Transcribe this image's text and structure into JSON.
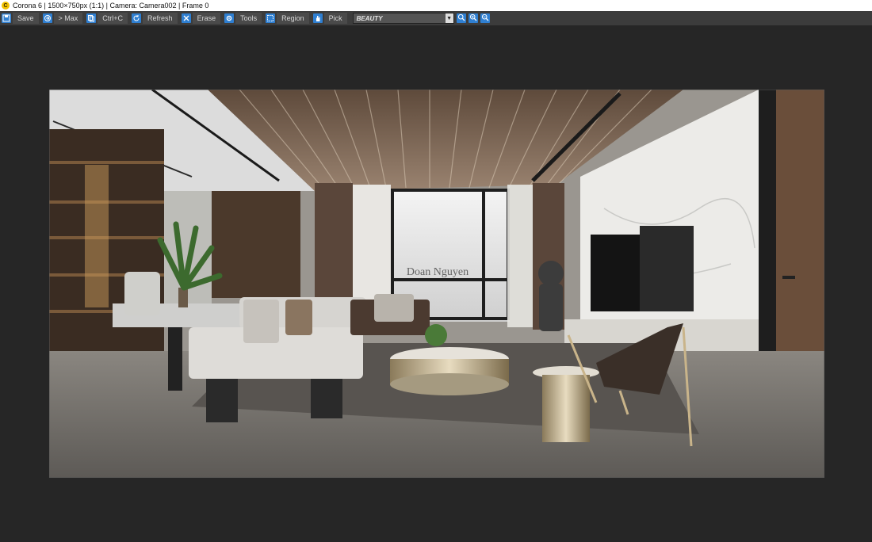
{
  "window": {
    "title": "Corona 6 | 1500×750px (1:1) | Camera: Camera002 | Frame 0",
    "icon": "corona-app-icon"
  },
  "toolbar": {
    "buttons": [
      {
        "label": "Save",
        "icon": "save-icon"
      },
      {
        "label": "> Max",
        "icon": "max-icon"
      },
      {
        "label": "Ctrl+C",
        "icon": "copy-icon"
      },
      {
        "label": "Refresh",
        "icon": "refresh-icon"
      },
      {
        "label": "Erase",
        "icon": "erase-icon"
      },
      {
        "label": "Tools",
        "icon": "gear-icon"
      },
      {
        "label": "Region",
        "icon": "region-icon"
      },
      {
        "label": "Pick",
        "icon": "pick-icon"
      }
    ],
    "render_pass": "BEAUTY",
    "zoom_icons": [
      "zoom-fit-icon",
      "zoom-in-icon",
      "zoom-out-icon"
    ],
    "accent_color": "#2f7fd1"
  },
  "render": {
    "watermark": "Doan Nguyen"
  }
}
